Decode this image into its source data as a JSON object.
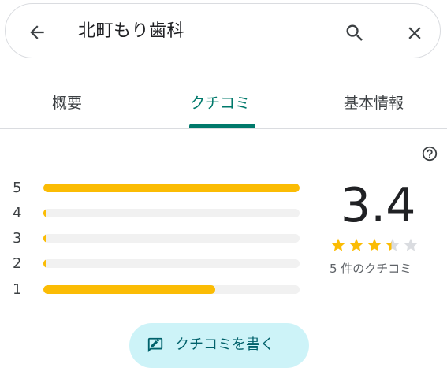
{
  "search": {
    "query": "北町もり歯科"
  },
  "tabs": [
    {
      "label": "概要"
    },
    {
      "label": "クチコミ",
      "active": true
    },
    {
      "label": "基本情報"
    }
  ],
  "rating": {
    "score": "3.4",
    "stars_value": 3.4,
    "review_count": "5 件のクチコミ",
    "histogram": [
      {
        "stars": "5",
        "fraction": 1.0
      },
      {
        "stars": "4",
        "fraction": 0.0
      },
      {
        "stars": "3",
        "fraction": 0.0
      },
      {
        "stars": "2",
        "fraction": 0.0
      },
      {
        "stars": "1",
        "fraction": 0.67
      }
    ]
  },
  "actions": {
    "write_review_label": "クチコミを書く"
  },
  "colors": {
    "accent": "#00796b",
    "star": "#fbbc04",
    "button_bg": "#cdf3f8"
  }
}
